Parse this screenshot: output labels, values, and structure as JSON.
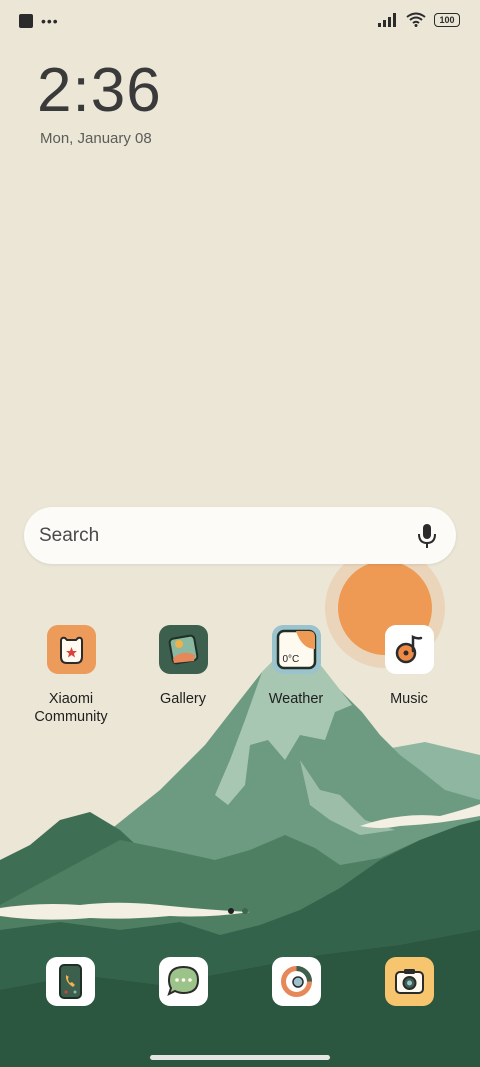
{
  "status_bar": {
    "notification_icons": [
      "square-icon",
      "more-dots-icon"
    ],
    "system_icons": [
      "signal-icon",
      "wifi-icon",
      "battery-icon"
    ],
    "battery_level": "100"
  },
  "lock_widget": {
    "time": "2:36",
    "date": "Mon, January 08"
  },
  "search": {
    "placeholder": "Search",
    "icon": "mic-icon"
  },
  "apps": [
    {
      "label": "Xiaomi\nCommunity",
      "icon": "xiaomi-community-icon",
      "bg": "#ec9b5a"
    },
    {
      "label": "Gallery",
      "icon": "gallery-icon",
      "bg": "#3d5f4d"
    },
    {
      "label": "Weather",
      "icon": "weather-icon",
      "bg": "#9bc3cd",
      "temp": "0°C"
    },
    {
      "label": "Music",
      "icon": "music-icon",
      "bg": "#ffffff"
    }
  ],
  "pager": {
    "page_count": 2,
    "current": 1
  },
  "dock": [
    {
      "icon": "phone-icon",
      "bg": "#ffffff"
    },
    {
      "icon": "messages-icon",
      "bg": "#ffffff"
    },
    {
      "icon": "browser-icon",
      "bg": "#ffffff"
    },
    {
      "icon": "camera-icon",
      "bg": "#f6c56d"
    }
  ],
  "colors": {
    "sky": "#ebe6d6",
    "sun": "#ee9a55",
    "mountain_light": "#8bb19c",
    "mountain_mid": "#6d9b82",
    "forest_dark": "#34634b"
  }
}
